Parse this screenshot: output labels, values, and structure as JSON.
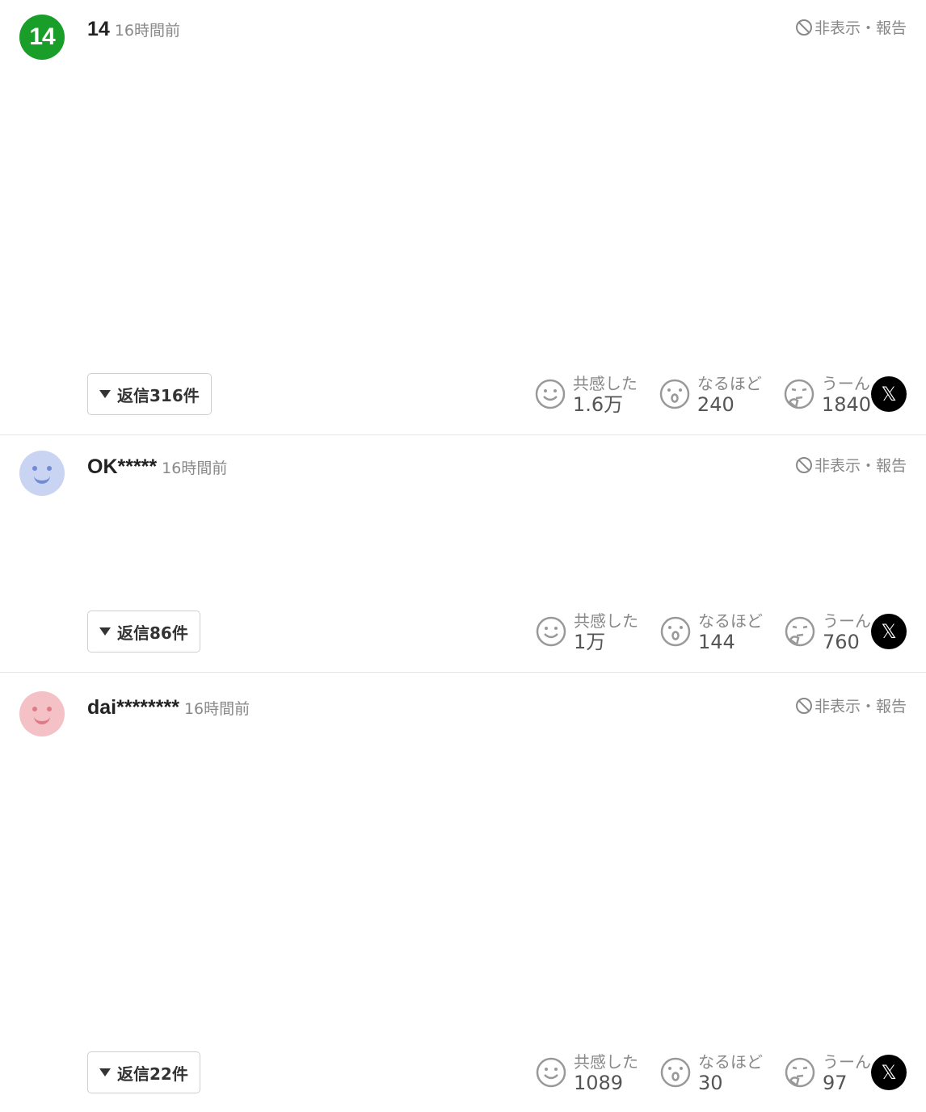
{
  "labels": {
    "hide_report": "非表示・報告",
    "empathy": "共感した",
    "insight": "なるほど",
    "hmm": "うーん"
  },
  "colors": {
    "badge_green": "#1a9e2a",
    "avatar_blue": "#c9d3f2",
    "avatar_pink": "#f3c1c6"
  },
  "comments": [
    {
      "badge": "14",
      "author": "14",
      "time": "16時間前",
      "replies": "返信316件",
      "empathy_count": "1.6万",
      "insight_count": "240",
      "hmm_count": "1840",
      "avatar_icon": "rank-badge-icon"
    },
    {
      "author": "OK*****",
      "time": "16時間前",
      "replies": "返信86件",
      "empathy_count": "1万",
      "insight_count": "144",
      "hmm_count": "760",
      "avatar_icon": "smiley-avatar-icon"
    },
    {
      "author": "dai********",
      "time": "16時間前",
      "replies": "返信22件",
      "empathy_count": "1089",
      "insight_count": "30",
      "hmm_count": "97",
      "avatar_icon": "smiley-avatar-icon"
    }
  ]
}
